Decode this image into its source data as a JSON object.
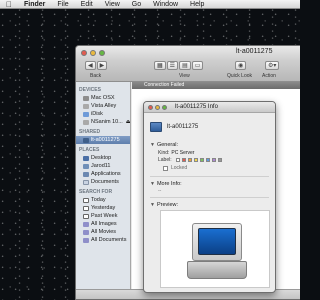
{
  "menubar": {
    "apple_icon": "apple-icon",
    "items": [
      "Finder",
      "File",
      "Edit",
      "View",
      "Go",
      "Window",
      "Help"
    ]
  },
  "finder": {
    "title": "lt-a0011275",
    "toolbar": {
      "back_label": "Back",
      "view_label": "View",
      "quicklook_label": "Quick Look",
      "action_label": "Action"
    },
    "connection_text": "Connection Failed",
    "sidebar": {
      "devices_header": "DEVICES",
      "devices": [
        "Mac OSX",
        "Vista Alley",
        "iDisk",
        "NSanim 10..."
      ],
      "shared_header": "SHARED",
      "shared": [
        "lt-a0011275"
      ],
      "places_header": "PLACES",
      "places": [
        "Desktop",
        "Jarod11",
        "Applications",
        "Documents"
      ],
      "search_header": "SEARCH FOR",
      "search": [
        "Today",
        "Yesterday",
        "Past Week",
        "All Images",
        "All Movies",
        "All Documents"
      ]
    }
  },
  "info": {
    "title": "lt-a0011275 Info",
    "name": "lt-a0011275",
    "general_label": "General:",
    "kind_key": "Kind:",
    "kind_value": "PC Server",
    "label_key": "Label:",
    "label_colors": [
      "#e45a4f",
      "#f2a23a",
      "#f5d94a",
      "#7cc65b",
      "#5f9be3",
      "#b088d6",
      "#9a9a9a"
    ],
    "locked_label": "Locked",
    "more_info_label": "More Info:",
    "more_info_value": "--",
    "preview_label": "Preview:"
  }
}
